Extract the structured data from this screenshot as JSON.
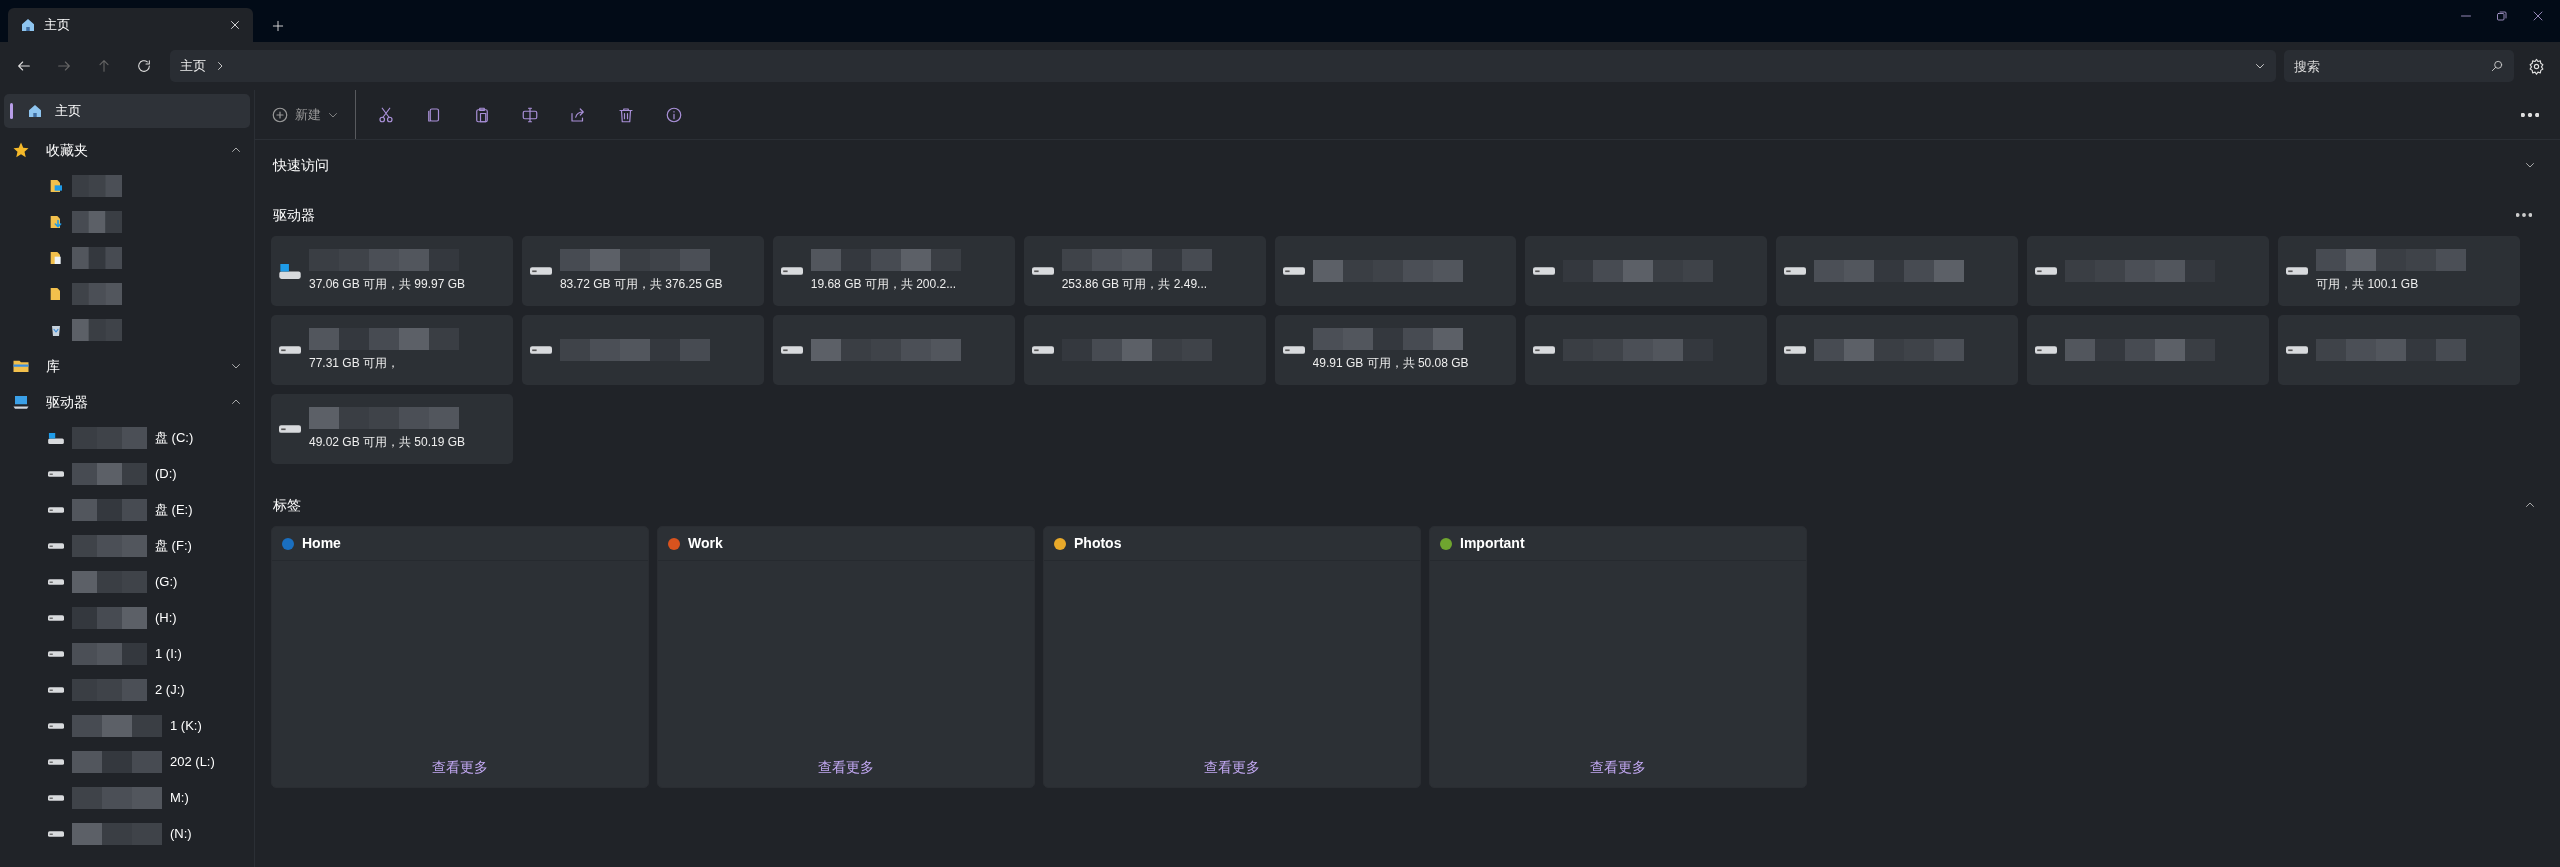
{
  "window": {
    "tabs": [
      {
        "label": "主页",
        "selected": true
      }
    ]
  },
  "navigation": {
    "back_enabled": true,
    "forward_enabled": false,
    "up_enabled": false,
    "breadcrumbs": [
      "主页"
    ],
    "search": {
      "placeholder": "搜索"
    }
  },
  "toolbar": {
    "new_label": "新建"
  },
  "sidebar": {
    "home": {
      "label": "主页",
      "selected": true
    },
    "sections": [
      {
        "label": "收藏夹",
        "kind": "favorites",
        "expanded": true,
        "children": [
          {
            "kind": "desktop"
          },
          {
            "kind": "downloads"
          },
          {
            "kind": "documents"
          },
          {
            "kind": "folder"
          },
          {
            "kind": "recycle"
          }
        ]
      },
      {
        "label": "库",
        "kind": "library",
        "expanded": false
      },
      {
        "label": "驱动器",
        "kind": "drives",
        "expanded": true,
        "children": [
          {
            "kind": "system",
            "label": "盘 (C:)"
          },
          {
            "kind": "drive",
            "label": "(D:)"
          },
          {
            "kind": "drive",
            "label": "盘 (E:)"
          },
          {
            "kind": "drive",
            "label": "盘 (F:)"
          },
          {
            "kind": "drive",
            "label": "(G:)"
          },
          {
            "kind": "drive",
            "label": "(H:)"
          },
          {
            "kind": "drive",
            "label": "1 (I:)"
          },
          {
            "kind": "drive",
            "label": "2 (J:)"
          },
          {
            "kind": "drive",
            "label": "1 (K:)"
          },
          {
            "kind": "drive",
            "label": "202 (L:)"
          },
          {
            "kind": "drive",
            "label": "M:)"
          },
          {
            "kind": "drive",
            "label": "(N:)"
          }
        ]
      }
    ]
  },
  "quick_access": {
    "title": "快速访问",
    "expanded": false
  },
  "drives": {
    "title": "驱动器",
    "items": [
      {
        "kind": "system",
        "usage": "37.06 GB 可用，共 99.97 GB"
      },
      {
        "kind": "drive",
        "usage": "83.72 GB 可用，共 376.25 GB"
      },
      {
        "kind": "drive",
        "usage": "19.68 GB 可用，共 200.2..."
      },
      {
        "kind": "drive",
        "usage": "253.86 GB 可用，共 2.49..."
      },
      {
        "kind": "drive"
      },
      {
        "kind": "drive"
      },
      {
        "kind": "drive"
      },
      {
        "kind": "drive"
      },
      {
        "kind": "drive",
        "usage": "可用，共 100.1 GB"
      },
      {
        "kind": "drive",
        "usage": "77.31 GB 可用，"
      },
      {
        "kind": "drive"
      },
      {
        "kind": "drive"
      },
      {
        "kind": "drive"
      },
      {
        "kind": "drive",
        "usage": "49.91 GB 可用，共 50.08 GB"
      },
      {
        "kind": "drive"
      },
      {
        "kind": "drive"
      },
      {
        "kind": "drive"
      },
      {
        "kind": "drive"
      },
      {
        "kind": "drive",
        "usage": "49.02 GB 可用，共 50.19 GB"
      }
    ]
  },
  "tags": {
    "title": "标签",
    "expanded": true,
    "items": [
      {
        "name": "Home",
        "color": "#1a6fc0",
        "link": "查看更多"
      },
      {
        "name": "Work",
        "color": "#d9531e",
        "link": "查看更多"
      },
      {
        "name": "Photos",
        "color": "#e8a92a",
        "link": "查看更多"
      },
      {
        "name": "Important",
        "color": "#6fa52f",
        "link": "查看更多"
      }
    ]
  }
}
